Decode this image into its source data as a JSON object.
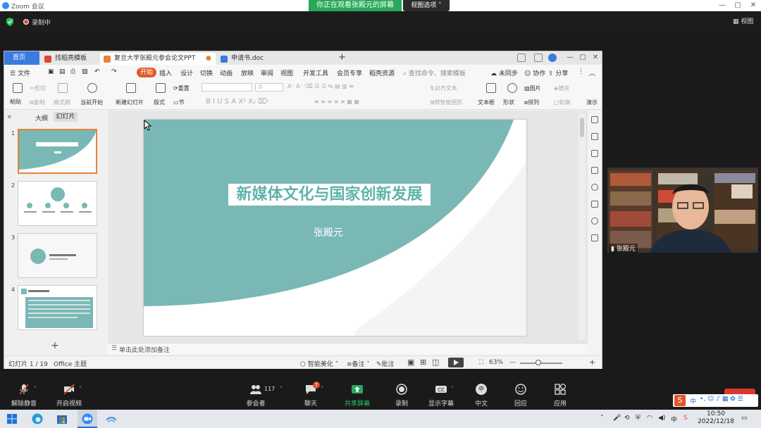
{
  "zoom": {
    "window_title": "Zoom 会议",
    "share_banner": "你正在观看张殿元的屏幕",
    "view_options": "视图选项",
    "recording": "录制中",
    "view_btn": "视图",
    "webcam_name": "张殿元"
  },
  "wps": {
    "tabs": {
      "home": "首页",
      "template": "找稻壳模板",
      "ppt": "复旦大学张殿元参会论文PPT",
      "doc": "申请书.doc",
      "plus": "+"
    },
    "menu": {
      "file": "文件",
      "start": "开始",
      "insert": "插入",
      "design": "设计",
      "transition": "切换",
      "animation": "动画",
      "slideshow": "放映",
      "review": "审阅",
      "view": "视图",
      "devtools": "开发工具",
      "member": "会员专享",
      "resources": "稻壳资源",
      "search": "查找命令、搜索模板",
      "unsync": "未同步",
      "collab": "协作",
      "share": "分享"
    },
    "toolbar": {
      "paste": "粘贴",
      "cut": "剪切",
      "copy": "复制",
      "format_painter": "格式刷",
      "from_current": "当前开始",
      "new_slide": "新建幻灯片",
      "layout": "版式",
      "section": "节",
      "reset": "重置",
      "font_size": "0",
      "text_effect": "对齐文本",
      "smart_shape": "转智能图形",
      "textbox": "文本框",
      "shape": "形状",
      "arrange": "排列",
      "picture": "图片",
      "fill": "填充",
      "outline": "轮廓",
      "present": "演示"
    },
    "panel": {
      "outline_tab": "大纲",
      "slides_tab": "幻灯片",
      "slide_numbers": [
        "1",
        "2",
        "3",
        "4"
      ],
      "add": "+"
    },
    "slide": {
      "title": "新媒体文化与国家创新发展",
      "author": "张殿元"
    },
    "notes_placeholder": "单击此处添加备注",
    "status": {
      "slide_count": "幻灯片 1 / 19",
      "theme": "Office 主题",
      "beautify": "智能美化",
      "notes": "备注",
      "comments": "批注",
      "zoom": "63%"
    }
  },
  "zoom_controls": {
    "unmute": "解除静音",
    "start_video": "开启视频",
    "participants": "参会者",
    "participants_count": "117",
    "chat": "聊天",
    "chat_badge": "7",
    "share": "共享屏幕",
    "record": "录制",
    "captions": "显示字幕",
    "chinese": "中文",
    "reactions": "回应",
    "apps": "应用"
  },
  "taskbar": {
    "time": "10:50",
    "date": "2022/12/18",
    "ime": "中"
  },
  "colors": {
    "teal": "#7ab8b6",
    "title_color": "#5fb3ae",
    "wps_orange": "#e25a2c",
    "zoom_green": "#27a85a"
  }
}
